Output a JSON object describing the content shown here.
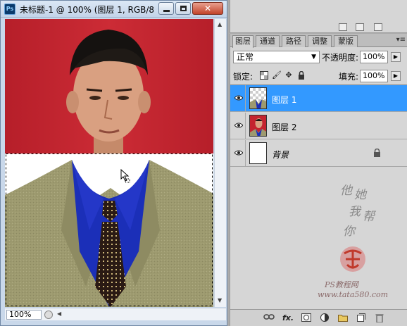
{
  "document": {
    "title": "未标题-1 @ 100% (图层 1, RGB/8...",
    "app_icon_text": "Ps",
    "zoom": "100%",
    "window_buttons": {
      "minimize": "minimize-icon",
      "maximize": "maximize-icon",
      "close": "close-icon"
    }
  },
  "layers_panel": {
    "tabs": [
      {
        "label": "图层",
        "active": true
      },
      {
        "label": "通道",
        "active": false
      },
      {
        "label": "路径",
        "active": false
      },
      {
        "label": "调整",
        "active": false
      },
      {
        "label": "蒙版",
        "active": false
      }
    ],
    "blend_mode": "正常",
    "opacity_label": "不透明度:",
    "opacity_value": "100%",
    "lock_label": "锁定:",
    "fill_label": "填充:",
    "fill_value": "100%",
    "layers": [
      {
        "name": "图层 1",
        "selected": true,
        "visible": true
      },
      {
        "name": "图层 2",
        "selected": false,
        "visible": true
      },
      {
        "name": "背景",
        "selected": false,
        "visible": true,
        "locked": true
      }
    ],
    "footer_buttons": [
      "link-icon",
      "fx-icon",
      "mask-icon",
      "adjustment-icon",
      "group-icon",
      "new-layer-icon",
      "trash-icon"
    ],
    "footer_fx_label": "fx."
  },
  "watermark": {
    "chars": [
      "他",
      "她",
      "我",
      "帮",
      "你"
    ],
    "line1": "PS教程网",
    "line2": "www.tata580.com"
  },
  "colors": {
    "selection": "#3399ff",
    "photo_background": "#c4232f",
    "shirt": "#1b2fb8",
    "suit": "#9d9a6f"
  }
}
